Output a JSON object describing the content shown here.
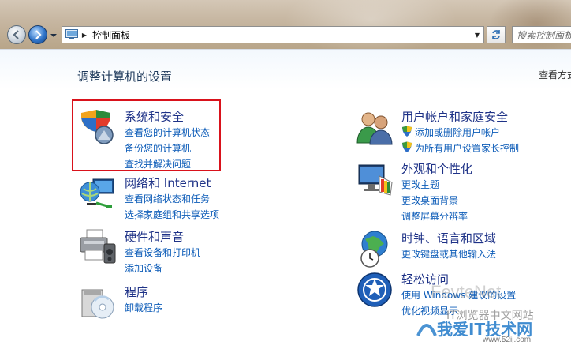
{
  "address_bar": {
    "breadcrumb": "控制面板",
    "search_placeholder": "搜索控制面板"
  },
  "main": {
    "title": "调整计算机的设置",
    "view_by": "查看方式"
  },
  "categories": [
    {
      "id": "system-security",
      "title": "系统和安全",
      "icon": "shield-computer-icon",
      "links": [
        "查看您的计算机状态",
        "备份您的计算机",
        "查找并解决问题"
      ]
    },
    {
      "id": "network-internet",
      "title": "网络和 Internet",
      "icon": "network-globe-icon",
      "links": [
        "查看网络状态和任务",
        "选择家庭组和共享选项"
      ]
    },
    {
      "id": "hardware-sound",
      "title": "硬件和声音",
      "icon": "printer-speaker-icon",
      "links": [
        "查看设备和打印机",
        "添加设备"
      ]
    },
    {
      "id": "programs",
      "title": "程序",
      "icon": "programs-cd-icon",
      "links": [
        "卸载程序"
      ]
    },
    {
      "id": "user-accounts",
      "title": "用户帐户和家庭安全",
      "icon": "users-icon",
      "links": [
        "添加或删除用户帐户",
        "为所有用户设置家长控制"
      ],
      "links_shielded": [
        true,
        true
      ]
    },
    {
      "id": "appearance",
      "title": "外观和个性化",
      "icon": "monitor-palette-icon",
      "links": [
        "更改主题",
        "更改桌面背景",
        "调整屏幕分辨率"
      ]
    },
    {
      "id": "clock-language-region",
      "title": "时钟、语言和区域",
      "icon": "globe-clock-icon",
      "links": [
        "更改键盘或其他输入法"
      ]
    },
    {
      "id": "ease-of-access",
      "title": "轻松访问",
      "icon": "ease-of-access-icon",
      "links": [
        "使用 Windows 建议的设置",
        "优化视频显示"
      ]
    }
  ],
  "watermark": {
    "line1": "FevteNet",
    "line2": "IT浏览器中文网站",
    "line3": "我爱IT技术网",
    "line4": "www.52ij.com"
  },
  "colors": {
    "category_title": "#1e3287",
    "link": "#0d5cb8",
    "highlight_box": "#d9121b",
    "page_title": "#1e395b"
  }
}
